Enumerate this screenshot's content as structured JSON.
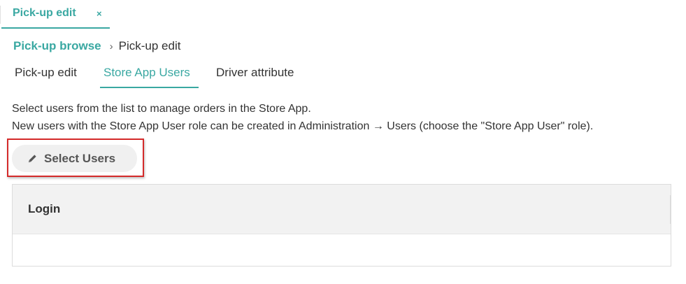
{
  "doc_tab": {
    "label": "Pick-up edit",
    "close_glyph": "×",
    "close_icon": "close-icon"
  },
  "breadcrumb": {
    "parent": "Pick-up browse",
    "separator": "›",
    "current": "Pick-up edit"
  },
  "tabs": [
    {
      "label": "Pick-up edit",
      "active": false
    },
    {
      "label": "Store App Users",
      "active": true
    },
    {
      "label": "Driver attribute",
      "active": false
    }
  ],
  "description": {
    "line1": "Select users from the list to manage orders in the Store App.",
    "line2": "New users with the Store App User role can be created in Administration → Users (choose the \"Store App User\" role)."
  },
  "select_button": {
    "label": "Select Users",
    "icon": "pencil-icon"
  },
  "table": {
    "columns": [
      "Login"
    ],
    "rows": []
  },
  "colors": {
    "accent": "#3aa8a2",
    "highlight": "#d42a2a"
  }
}
